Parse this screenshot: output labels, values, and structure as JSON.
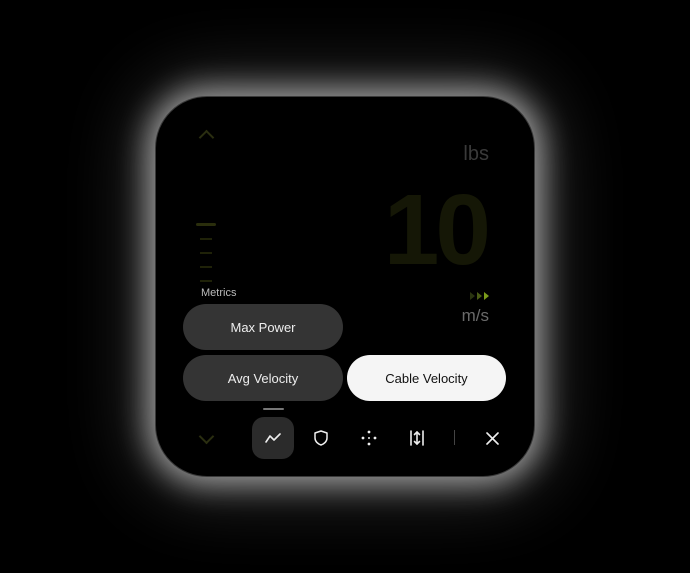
{
  "weight": {
    "value": "10",
    "unit": "lbs"
  },
  "velocity": {
    "unit": "m/s"
  },
  "metrics": {
    "label": "Metrics",
    "options": [
      {
        "label": "Max Power",
        "selected": false
      },
      {
        "label": "Avg Velocity",
        "selected": false
      },
      {
        "label": "Cable Velocity",
        "selected": true
      }
    ]
  },
  "toolbar": {
    "items": [
      "chart-line-icon",
      "shield-icon",
      "move-icon",
      "vertical-adjust-icon",
      "close-icon"
    ],
    "active": "chart-line-icon"
  },
  "colors": {
    "accent": "#7a9a1a",
    "selected_bg": "#f5f5f5"
  }
}
